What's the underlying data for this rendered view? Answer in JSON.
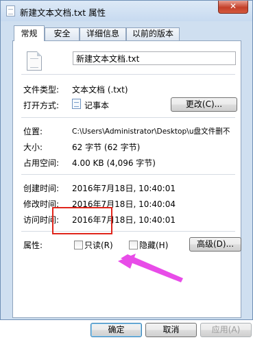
{
  "window": {
    "title": "新建文本文档.txt 属性",
    "close_label": "✕"
  },
  "tabs": [
    {
      "label": "常规",
      "active": true
    },
    {
      "label": "安全",
      "active": false
    },
    {
      "label": "详细信息",
      "active": false
    },
    {
      "label": "以前的版本",
      "active": false
    }
  ],
  "general": {
    "file_name": "新建文本文档.txt",
    "file_type_label": "文件类型:",
    "file_type_value": "文本文档 (.txt)",
    "open_with_label": "打开方式:",
    "open_with_value": "记事本",
    "change_button": "更改(C)...",
    "location_label": "位置:",
    "location_value": "C:\\Users\\Administrator\\Desktop\\u盘文件删不",
    "size_label": "大小:",
    "size_value": "62 字节 (62 字节)",
    "size_on_disk_label": "占用空间:",
    "size_on_disk_value": "4.00 KB (4,096 字节)",
    "created_label": "创建时间:",
    "created_value": "2016年7月18日, 10:40:01",
    "modified_label": "修改时间:",
    "modified_value": "2016年7月18日, 10:40:04",
    "accessed_label": "访问时间:",
    "accessed_value": "2016年7月18日, 10:40:01",
    "attributes_label": "属性:",
    "readonly_label": "只读(R)",
    "readonly_checked": false,
    "hidden_label": "隐藏(H)",
    "hidden_checked": false,
    "advanced_button": "高级(D)..."
  },
  "footer": {
    "ok": "确定",
    "cancel": "取消",
    "apply": "应用(A)"
  },
  "colors": {
    "highlight": "#e0241a",
    "arrow": "#e84ce8",
    "window_frame": "#cfdff0"
  },
  "icons": [
    "text-file-icon",
    "notepad-icon",
    "close-icon",
    "pointer-arrow"
  ]
}
